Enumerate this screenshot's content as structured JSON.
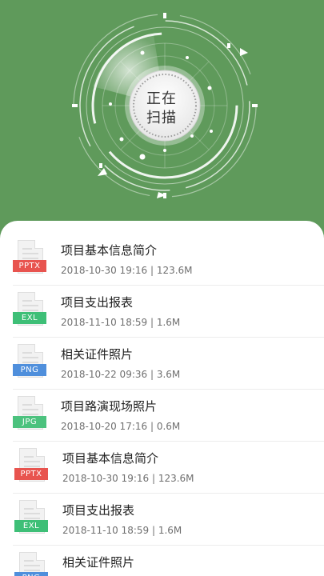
{
  "scan": {
    "line1": "正在",
    "line2": "扫描"
  },
  "colors": {
    "header_bg": "#5f9a5b",
    "pptx": "#e8544f",
    "exl": "#3ebf77",
    "png": "#4f8fdc",
    "jpg": "#4cc27e"
  },
  "files": [
    {
      "type": "PPTX",
      "name": "项目基本信息简介",
      "date": "2018-10-30 19:16",
      "size": "123.6M",
      "color": "#e8544f"
    },
    {
      "type": "EXL",
      "name": "项目支出报表",
      "date": "2018-11-10 18:59",
      "size": "1.6M",
      "color": "#3ebf77"
    },
    {
      "type": "PNG",
      "name": "相关证件照片",
      "date": "2018-10-22 09:36",
      "size": "3.6M",
      "color": "#4f8fdc"
    },
    {
      "type": "JPG",
      "name": "项目路演现场照片",
      "date": "2018-10-20 17:16",
      "size": "0.6M",
      "color": "#4cc27e"
    },
    {
      "type": "PPTX",
      "name": "项目基本信息简介",
      "date": "2018-10-30 19:16",
      "size": "123.6M",
      "color": "#e8544f"
    },
    {
      "type": "EXL",
      "name": "项目支出报表",
      "date": "2018-11-10 18:59",
      "size": "1.6M",
      "color": "#3ebf77"
    },
    {
      "type": "PNG",
      "name": "相关证件照片",
      "date": "",
      "size": "",
      "color": "#4f8fdc"
    }
  ]
}
